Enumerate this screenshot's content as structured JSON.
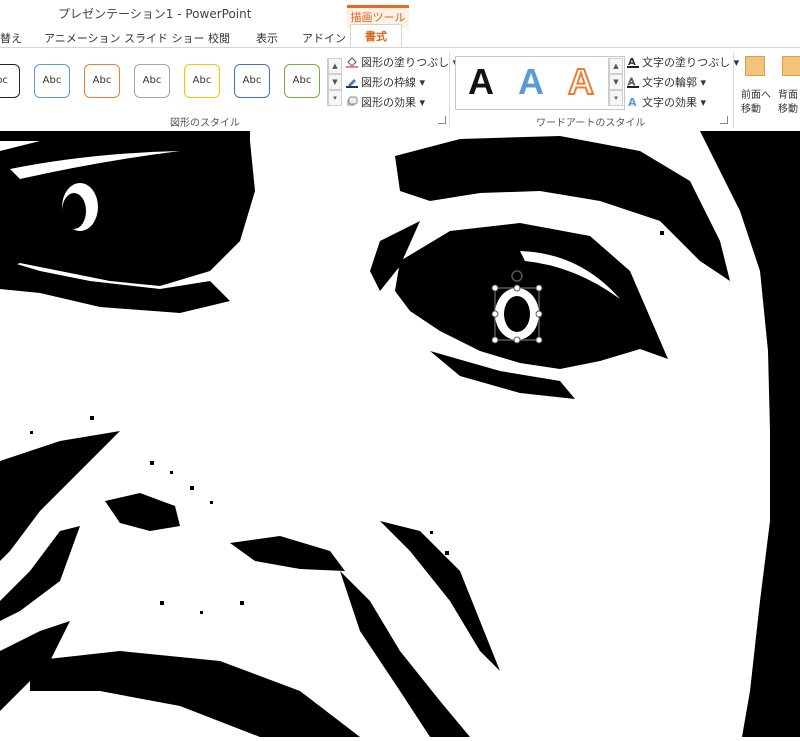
{
  "titlebar": {
    "title": "プレゼンテーション1 - PowerPoint",
    "context_tool": "描画ツール"
  },
  "tabs": [
    "替え",
    "アニメーション",
    "スライド ショー",
    "校閲",
    "表示",
    "アドイン"
  ],
  "active_tab": "書式",
  "shape_styles": {
    "tile_label": "Abc",
    "tiles": [
      {
        "label": "bc",
        "border": "#222222",
        "fill": "#ffffff"
      },
      {
        "label": "Abc",
        "border": "#5b9bd5",
        "fill": "#ffffff"
      },
      {
        "label": "Abc",
        "border": "#ed7d31",
        "fill": "#ffffff"
      },
      {
        "label": "Abc",
        "border": "#a5a5a5",
        "fill": "#ffffff"
      },
      {
        "label": "Abc",
        "border": "#ffc000",
        "fill": "#ffffff"
      },
      {
        "label": "Abc",
        "border": "#4472c4",
        "fill": "#ffffff"
      },
      {
        "label": "Abc",
        "border": "#70ad47",
        "fill": "#ffffff"
      }
    ],
    "fill_cmd": "図形の塗りつぶし",
    "outline_cmd": "図形の枠線",
    "effect_cmd": "図形の効果",
    "group_label": "図形のスタイル"
  },
  "wordart": {
    "letters": [
      {
        "char": "A",
        "color": "#111111"
      },
      {
        "char": "A",
        "color": "#5b9bd5"
      },
      {
        "char": "A",
        "color": "#ed7d31"
      }
    ],
    "fill_cmd": "文字の塗りつぶし",
    "outline_cmd": "文字の輪郭",
    "effect_cmd": "文字の効果",
    "group_label": "ワードアートのスタイル"
  },
  "arrange": {
    "bring_forward_1": "前面へ",
    "bring_forward_2": "移動",
    "send_backward_1": "背面",
    "send_backward_2": "移動"
  },
  "colors": {
    "accent": "#d9661c",
    "ribbon_border": "#d4d4d4"
  }
}
